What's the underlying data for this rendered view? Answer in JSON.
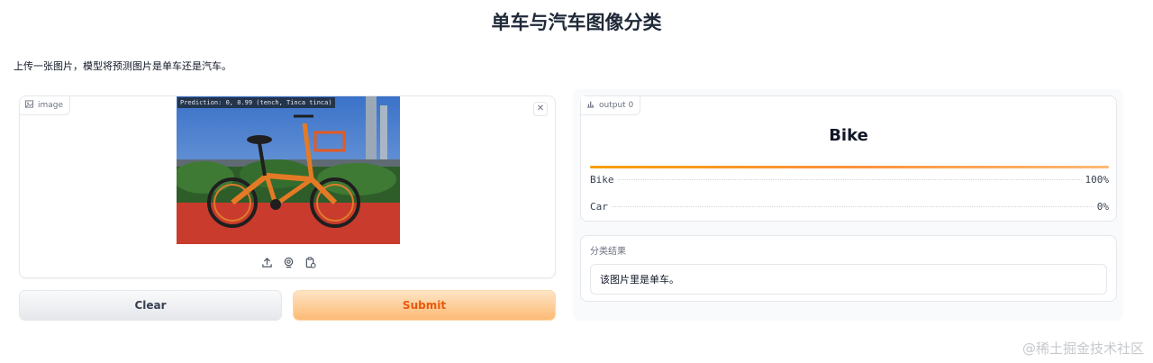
{
  "page": {
    "title": "单车与汽车图像分类",
    "description": "上传一张图片，模型将预测图片是单车还是汽车。"
  },
  "input": {
    "label": "image",
    "label_icon": "image-icon",
    "clear_icon": "close-icon",
    "prediction_overlay": "Prediction: 0, 0.99 (tench, Tinca tinca)",
    "tools": [
      "upload-icon",
      "webcam-icon",
      "clipboard-icon"
    ]
  },
  "buttons": {
    "clear": "Clear",
    "submit": "Submit"
  },
  "output": {
    "label": "output 0",
    "label_icon": "bar-chart-icon",
    "top_class": "Bike",
    "confidences": [
      {
        "label": "Bike",
        "value": "100%",
        "fraction": 1.0
      },
      {
        "label": "Car",
        "value": "0%",
        "fraction": 0.0
      }
    ]
  },
  "result": {
    "label": "分类结果",
    "value": "该图片里是单车。"
  },
  "watermark": "@稀土掘金技术社区",
  "colors": {
    "accent": "#ea580c",
    "submit_bg": "#fdba74",
    "bar": "#fb923c"
  }
}
